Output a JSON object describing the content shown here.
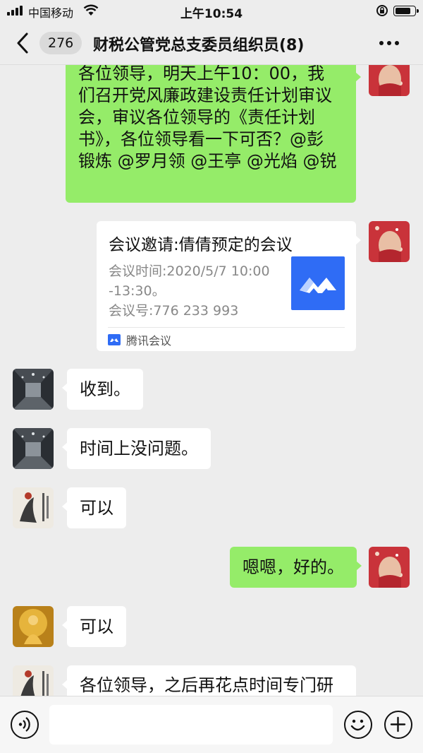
{
  "status_bar": {
    "carrier": "中国移动",
    "time": "上午10:54",
    "battery_level": 0.85
  },
  "nav": {
    "unread_count": "276",
    "title": "财税公管党总支委员组织员(8)"
  },
  "messages": [
    {
      "side": "right",
      "avatar": "woman-face-photo",
      "lines": [
        "各位领导，明天上午10：00，我",
        "们召开党风廉政建设责任计划审议",
        "会，审议各位领导的《责任计划",
        "书》，各位领导看一下可否？@彭",
        "锻炼 @罗月领 @王亭 @光焰 @锐"
      ]
    },
    {
      "side": "right",
      "avatar": "woman-face-photo",
      "type": "meeting-card",
      "title": "会议邀请:倩倩预定的会议",
      "desc_lines": [
        "会议时间:2020/5/7 10:00",
        "-13:30。",
        "会议号:776 233 993"
      ],
      "source": "腾讯会议"
    },
    {
      "side": "left",
      "avatar": "corridor-photo",
      "text": "收到。"
    },
    {
      "side": "left",
      "avatar": "corridor-photo",
      "text": "时间上没问题。"
    },
    {
      "side": "left",
      "avatar": "calligraphy-painting",
      "text": "可以"
    },
    {
      "side": "right",
      "avatar": "woman-face-photo",
      "text": "嗯嗯，好的。"
    },
    {
      "side": "left",
      "avatar": "golden-buddha-photo",
      "text": "可以"
    },
    {
      "side": "left",
      "avatar": "calligraphy-painting",
      "text": "各位领导，之后再花点时间专门研"
    }
  ],
  "colors": {
    "background": "#ededed",
    "own_bubble": "#95ec69",
    "other_bubble": "#ffffff",
    "tencent_meeting_blue": "#2f6cf5"
  }
}
